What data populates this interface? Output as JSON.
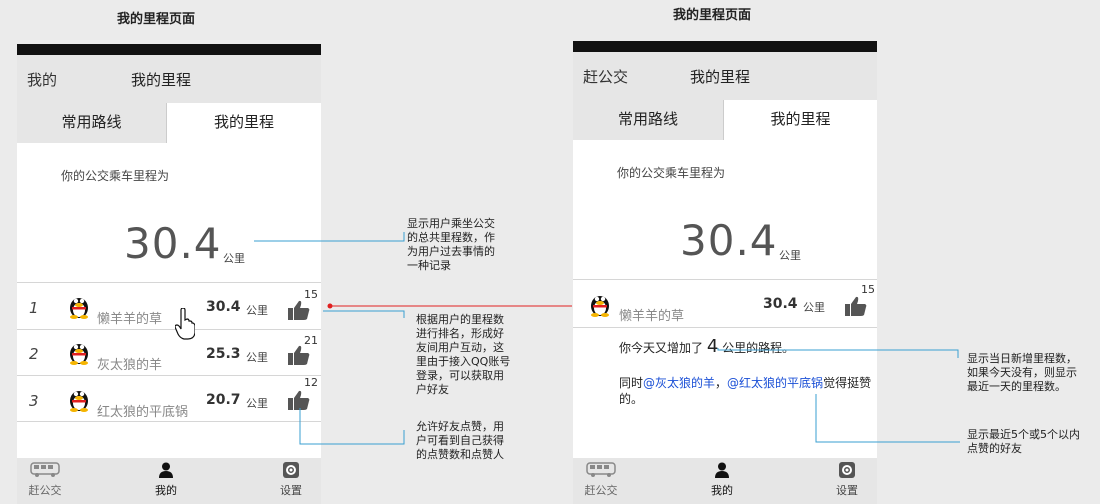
{
  "page_titles": [
    "我的里程页面",
    "我的里程页面"
  ],
  "phone_left": {
    "nav_back": "我的",
    "nav_title": "我的里程",
    "tabs": [
      "常用路线",
      "我的里程"
    ],
    "intro": "你的公交乘车里程为",
    "total": "30.4",
    "total_unit": "公里",
    "ranking": [
      {
        "rank": "1",
        "name": "懒羊羊的草",
        "value": "30.4",
        "unit": "公里",
        "likes": "15"
      },
      {
        "rank": "2",
        "name": "灰太狼的羊",
        "value": "25.3",
        "unit": "公里",
        "likes": "21"
      },
      {
        "rank": "3",
        "name": "红太狼的平底锅",
        "value": "20.7",
        "unit": "公里",
        "likes": "12"
      }
    ],
    "tabbar": [
      "赶公交",
      "我的",
      "设置"
    ]
  },
  "phone_right": {
    "nav_back": "赶公交",
    "nav_title": "我的里程",
    "tabs": [
      "常用路线",
      "我的里程"
    ],
    "intro": "你的公交乘车里程为",
    "total": "30.4",
    "total_unit": "公里",
    "friend": {
      "name": "懒羊羊的草",
      "value": "30.4",
      "unit": "公里",
      "likes": "15"
    },
    "today_prefix": "你今天又增加了",
    "today_value": "4",
    "today_suffix": "公里的路程。",
    "likers_prefix": "同时",
    "liker1": "@灰太狼的羊",
    "liker_sep": "，",
    "liker2": "@红太狼的平底锅",
    "likers_suffix": "觉得挺赞",
    "likers_end": "的。",
    "tabbar": [
      "赶公交",
      "我的",
      "设置"
    ]
  },
  "annotations": {
    "total_note": [
      "显示用户乘坐公交",
      "的总共里程数，作",
      "为用户过去事情的",
      "一种记录"
    ],
    "ranking_note": [
      "根据用户的里程数",
      "进行排名，形成好",
      "友间用户互动，这",
      "里由于接入QQ账号",
      "登录，可以获取用",
      "户好友"
    ],
    "like_note": [
      "允许好友点赞，用",
      "户可看到自己获得",
      "的点赞数和点赞人"
    ],
    "today_note": [
      "显示当日新增里程数，",
      "如果今天没有，则显示",
      "最近一天的里程数。"
    ],
    "likers_note": [
      "显示最近5个或5个以内",
      "点赞的好友"
    ]
  },
  "colors": {
    "annotation_line": "#3a9fd0",
    "connector_red": "#e02020",
    "mention": "#1a4fd6"
  }
}
